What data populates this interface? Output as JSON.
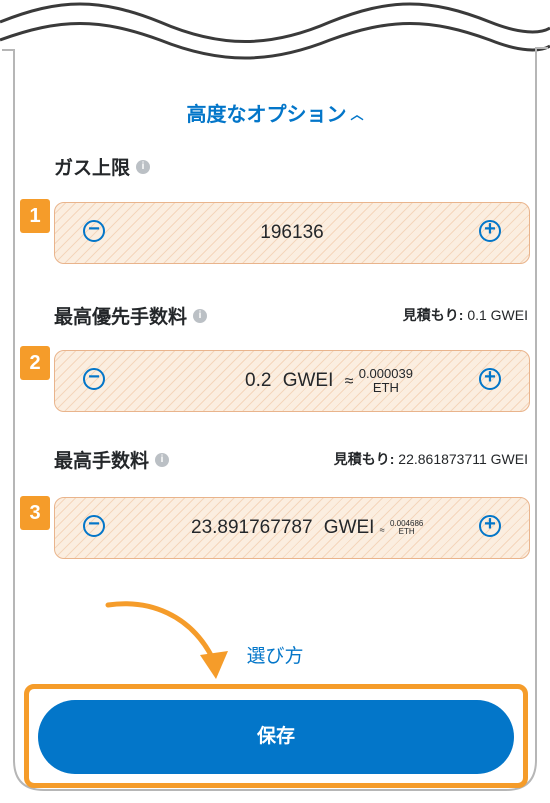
{
  "advanced_options": {
    "label": "高度なオプション",
    "chevron": "^"
  },
  "gas_limit": {
    "label": "ガス上限",
    "value": "196136",
    "badge": "1"
  },
  "max_priority_fee": {
    "label": "最高優先手数料",
    "estimate_label": "見積もり:",
    "estimate_value": "0.1 GWEI",
    "value": "0.2",
    "unit": "GWEI",
    "approx_symbol": "≈",
    "eth_value": "0.000039",
    "eth_unit": "ETH",
    "badge": "2"
  },
  "max_fee": {
    "label": "最高手数料",
    "estimate_label": "見積もり:",
    "estimate_value": "22.861873711 GWEI",
    "value": "23.891767787",
    "unit": "GWEI",
    "approx_symbol": "≈",
    "eth_value": "0.004686",
    "eth_unit": "ETH",
    "badge": "3"
  },
  "how_to_choose": "選び方",
  "save_label": "保存",
  "colors": {
    "accent": "#0376c9",
    "highlight": "#f59c2a",
    "field_border": "#e9b48c"
  },
  "icons": {
    "info": "info-icon",
    "minus": "minus-circle-icon",
    "plus": "plus-circle-icon",
    "arrow": "curved-arrow-icon"
  }
}
